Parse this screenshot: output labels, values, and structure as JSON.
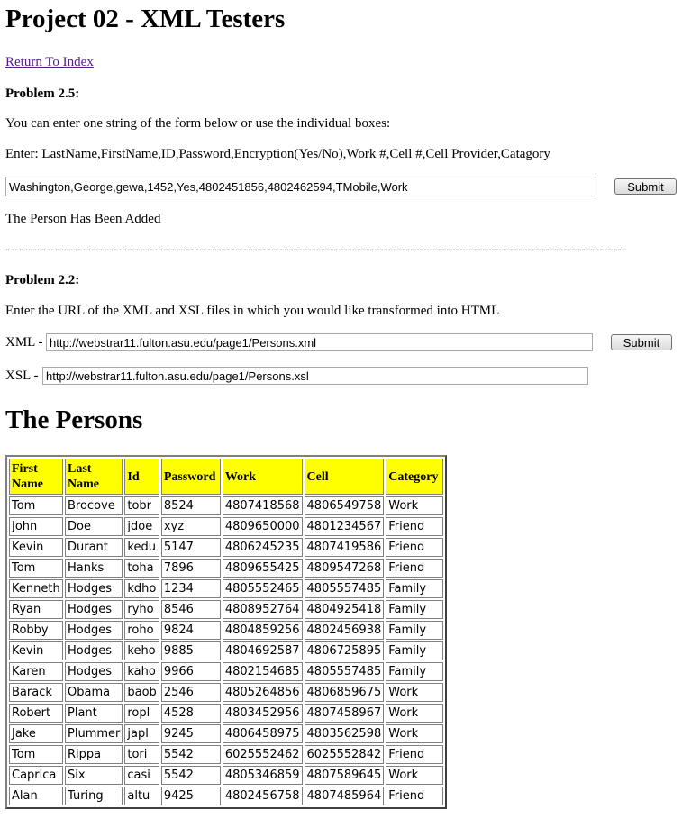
{
  "page_title": "Project 02 - XML Testers",
  "return_link": "Return To Index",
  "problem25": {
    "heading": "Problem 2.5:",
    "instruction": "You can enter one string of the form below or use the individual boxes:",
    "format": "Enter: LastName,FirstName,ID,Password,Encryption(Yes/No),Work #,Cell #,Cell Provider,Catagory",
    "input_value": "Washington,George,gewa,1452,Yes,4802451856,4802462594,TMobile,Work",
    "submit_label": "Submit",
    "status": "The Person Has Been Added"
  },
  "divider": "------------------------------------------------------------------------------------------------------------------------------------------",
  "problem22": {
    "heading": "Problem 2.2:",
    "instruction": "Enter the URL of the XML and XSL files in which you would like transformed into HTML",
    "xml_label": "XML -",
    "xml_value": "http://webstrar11.fulton.asu.edu/page1/Persons.xml",
    "xsl_label": "XSL -",
    "xsl_value": "http://webstrar11.fulton.asu.edu/page1/Persons.xsl",
    "submit_label": "Submit"
  },
  "persons_title": "The Persons",
  "persons_table": {
    "headers": [
      "First Name",
      "Last Name",
      "Id",
      "Password",
      "Work",
      "Cell",
      "Category"
    ],
    "rows": [
      [
        "Tom",
        "Brocove",
        "tobr",
        "8524",
        "4807418568",
        "4806549758",
        "Work"
      ],
      [
        "John",
        "Doe",
        "jdoe",
        "xyz",
        "4809650000",
        "4801234567",
        "Friend"
      ],
      [
        "Kevin",
        "Durant",
        "kedu",
        "5147",
        "4806245235",
        "4807419586",
        "Friend"
      ],
      [
        "Tom",
        "Hanks",
        "toha",
        "7896",
        "4809655425",
        "4809547268",
        "Friend"
      ],
      [
        "Kenneth",
        "Hodges",
        "kdho",
        "1234",
        "4805552465",
        "4805557485",
        "Family"
      ],
      [
        "Ryan",
        "Hodges",
        "ryho",
        "8546",
        "4808952764",
        "4804925418",
        "Family"
      ],
      [
        "Robby",
        "Hodges",
        "roho",
        "9824",
        "4804859256",
        "4802456938",
        "Family"
      ],
      [
        "Kevin",
        "Hodges",
        "keho",
        "9885",
        "4804692587",
        "4806725895",
        "Family"
      ],
      [
        "Karen",
        "Hodges",
        "kaho",
        "9966",
        "4802154685",
        "4805557485",
        "Family"
      ],
      [
        "Barack",
        "Obama",
        "baob",
        "2546",
        "4805264856",
        "4806859675",
        "Work"
      ],
      [
        "Robert",
        "Plant",
        "ropl",
        "4528",
        "4803452956",
        "4807458967",
        "Work"
      ],
      [
        "Jake",
        "Plummer",
        "japl",
        "9245",
        "4806458975",
        "4803562598",
        "Work"
      ],
      [
        "Tom",
        "Rippa",
        "tori",
        "5542",
        "6025552462",
        "6025552842",
        "Friend"
      ],
      [
        "Caprica",
        "Six",
        "casi",
        "5542",
        "4805346859",
        "4807589645",
        "Work"
      ],
      [
        "Alan",
        "Turing",
        "altu",
        "9425",
        "4802456758",
        "4807485964",
        "Friend"
      ]
    ]
  },
  "colors": {
    "header_bg": "#ffff00",
    "link": "#551a8b"
  }
}
